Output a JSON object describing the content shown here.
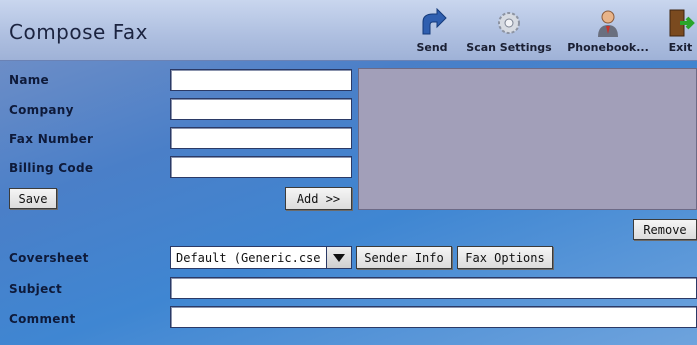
{
  "header": {
    "title": "Compose Fax",
    "toolbar": [
      {
        "label": "Send",
        "icon": "send-icon"
      },
      {
        "label": "Scan Settings",
        "icon": "scan-settings-icon"
      },
      {
        "label": "Phonebook...",
        "icon": "phonebook-icon"
      },
      {
        "label": "Exit",
        "icon": "exit-icon"
      }
    ]
  },
  "recipient": {
    "name_label": "Name",
    "company_label": "Company",
    "fax_number_label": "Fax Number",
    "billing_code_label": "Billing Code",
    "name_value": "",
    "company_value": "",
    "fax_number_value": "",
    "billing_code_value": "",
    "save_label": "Save",
    "add_label": "Add >>",
    "remove_label": "Remove"
  },
  "coversheet": {
    "label": "Coversheet",
    "selected": "Default (Generic.cse",
    "sender_info_label": "Sender Info",
    "fax_options_label": "Fax Options"
  },
  "subject": {
    "label": "Subject",
    "value": ""
  },
  "comment": {
    "label": "Comment",
    "value": ""
  },
  "colors": {
    "header_bg": "#aebfe0",
    "body_bg": "#4a7fc8",
    "recipient_list_bg": "#a29fb9"
  }
}
